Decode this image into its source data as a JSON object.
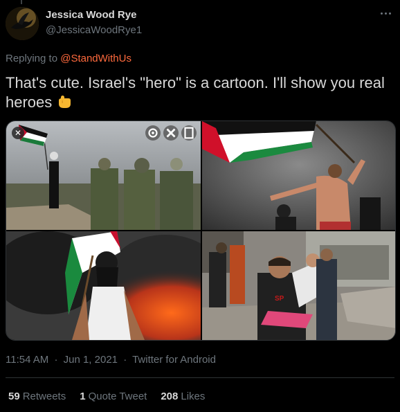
{
  "author": {
    "display_name": "Jessica Wood Rye",
    "handle": "@JessicaWoodRye1"
  },
  "reply": {
    "prefix": "Replying to",
    "mention": "@StandWithUs"
  },
  "tweet": {
    "text": "That's cute. Israel's \"hero\" is a cartoon. I'll show you real heroes",
    "emoji": "backhand-index-pointing-down"
  },
  "media": {
    "images": [
      {
        "name": "woman-with-flag-and-soldiers"
      },
      {
        "name": "shirtless-man-waving-flag"
      },
      {
        "name": "masked-youth-with-flag"
      },
      {
        "name": "man-carrying-child"
      }
    ],
    "tool_icons": [
      "scan-icon",
      "close-icon",
      "save-icon"
    ]
  },
  "meta": {
    "time": "11:54 AM",
    "date": "Jun 1, 2021",
    "source": "Twitter for Android",
    "separator": "·"
  },
  "stats": {
    "retweets_count": "59",
    "retweets_label": "Retweets",
    "quotes_count": "1",
    "quotes_label": "Quote Tweet",
    "likes_count": "208",
    "likes_label": "Likes"
  },
  "colors": {
    "background": "#000000",
    "mention": "#ff6a3d",
    "muted": "#6e767d",
    "text": "#d9d9d9"
  }
}
